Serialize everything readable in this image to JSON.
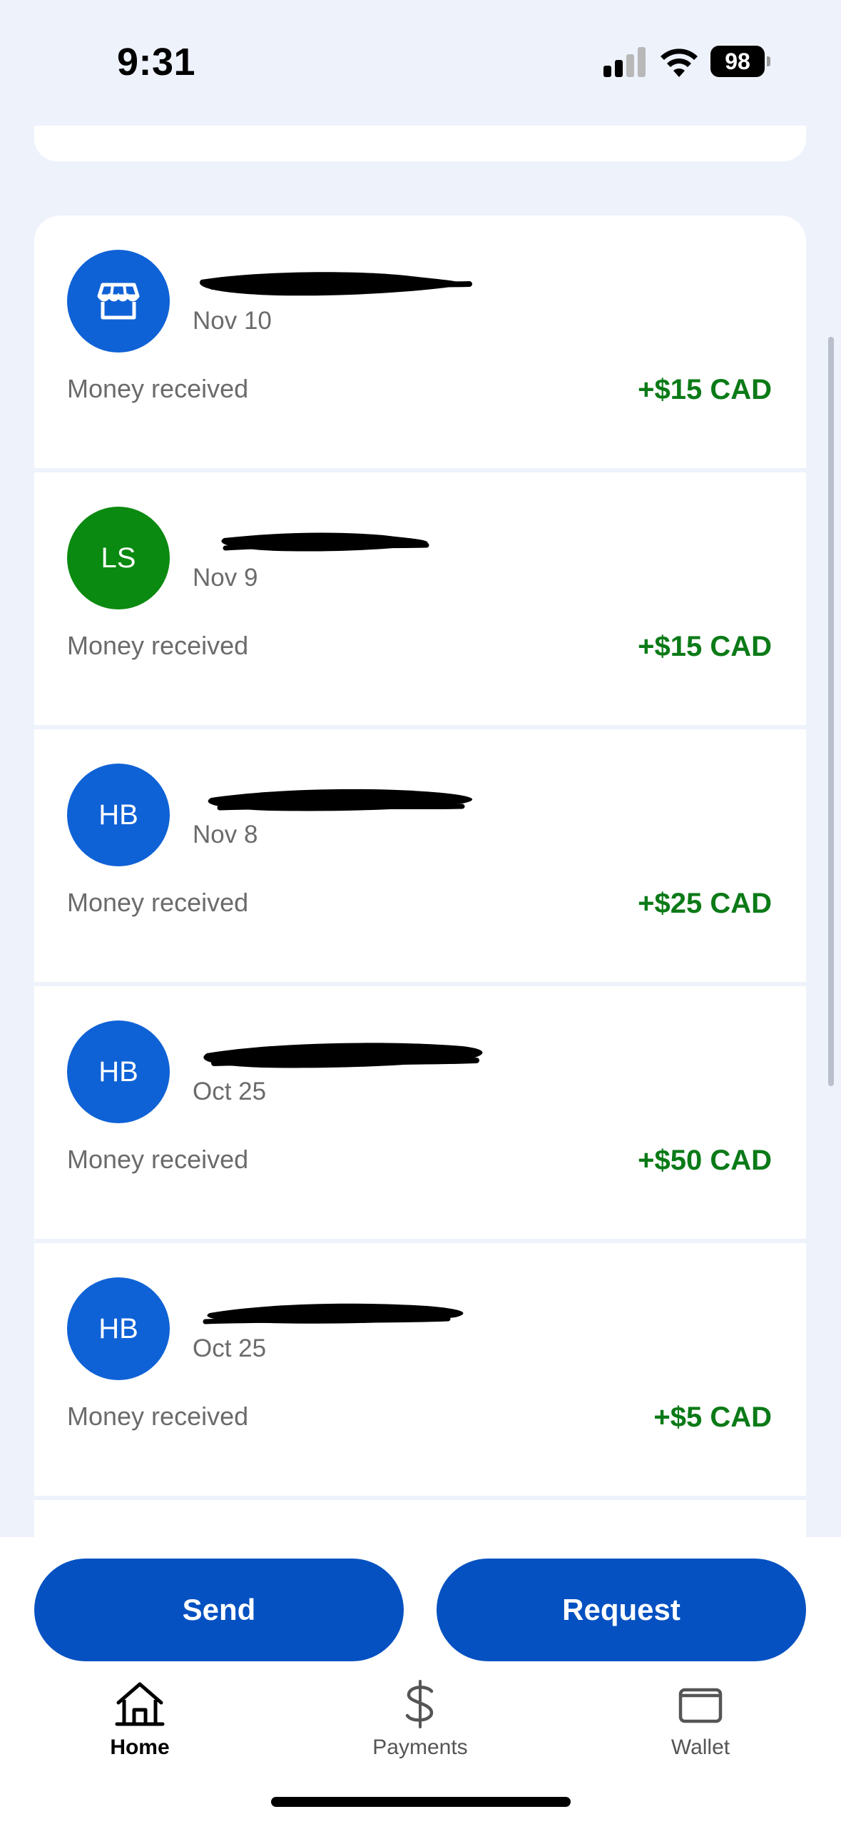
{
  "status_bar": {
    "time": "9:31",
    "battery": "98",
    "signal_icon": "cellular-signal-icon",
    "wifi_icon": "wifi-icon"
  },
  "transactions": [
    {
      "avatar_type": "store-icon",
      "avatar_text": "",
      "avatar_color": "#0f62d6",
      "date": "Nov 10",
      "description": "Money received",
      "amount": "+$15 CAD"
    },
    {
      "avatar_type": "initials",
      "avatar_text": "LS",
      "avatar_color": "#0a8a10",
      "date": "Nov 9",
      "description": "Money received",
      "amount": "+$15 CAD"
    },
    {
      "avatar_type": "initials",
      "avatar_text": "HB",
      "avatar_color": "#0f62d6",
      "date": "Nov 8",
      "description": "Money received",
      "amount": "+$25 CAD"
    },
    {
      "avatar_type": "initials",
      "avatar_text": "HB",
      "avatar_color": "#0f62d6",
      "date": "Oct 25",
      "description": "Money received",
      "amount": "+$50 CAD"
    },
    {
      "avatar_type": "initials",
      "avatar_text": "HB",
      "avatar_color": "#0f62d6",
      "date": "Oct 25",
      "description": "Money received",
      "amount": "+$5 CAD"
    }
  ],
  "actions": {
    "send_label": "Send",
    "request_label": "Request"
  },
  "tabs": [
    {
      "label": "Home",
      "icon": "home-icon",
      "active": true
    },
    {
      "label": "Payments",
      "icon": "dollar-icon",
      "active": false
    },
    {
      "label": "Wallet",
      "icon": "wallet-icon",
      "active": false
    }
  ],
  "colors": {
    "primary": "#0551c1",
    "amount_green": "#0b7a17",
    "background": "#eef2fb"
  }
}
